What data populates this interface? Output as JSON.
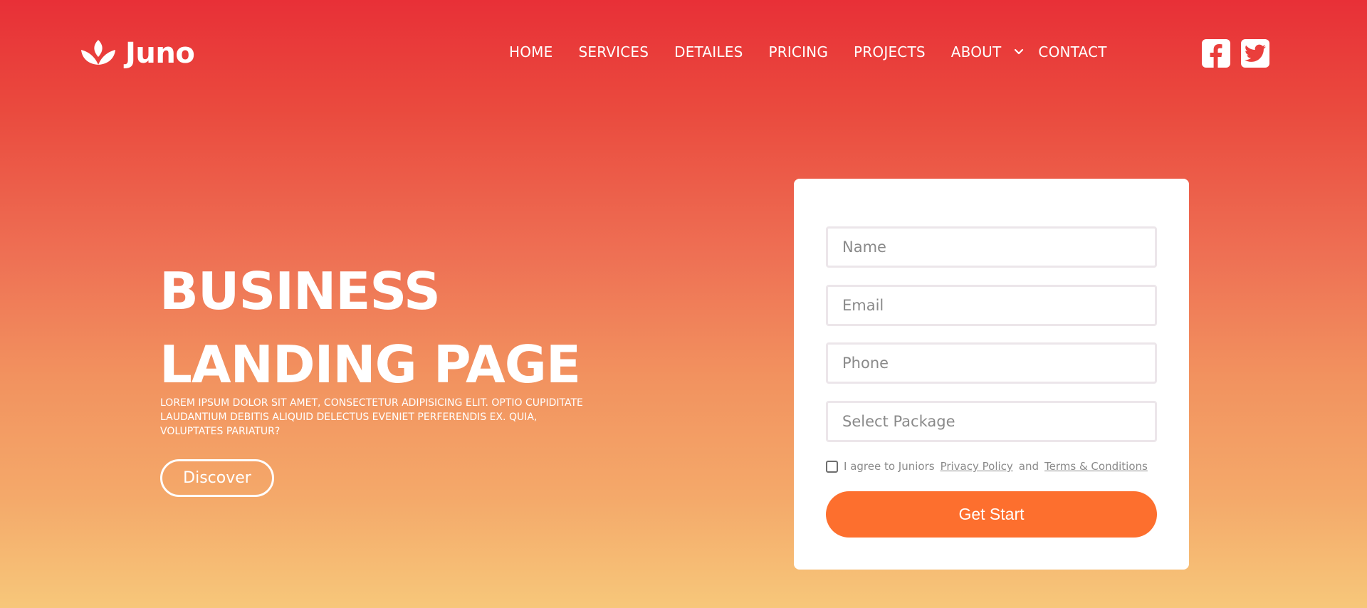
{
  "brand": {
    "name": "Juno",
    "icon": "lotus-icon"
  },
  "nav": {
    "items": [
      {
        "label": "HOME"
      },
      {
        "label": "SERVICES"
      },
      {
        "label": "DETAILES"
      },
      {
        "label": "PRICING"
      },
      {
        "label": "PROJECTS"
      },
      {
        "label": "ABOUT"
      },
      {
        "label": "CONTACT"
      }
    ],
    "about_dropdown_icon": "chevron-down-icon"
  },
  "socials": [
    {
      "name": "facebook",
      "icon": "facebook-icon"
    },
    {
      "name": "twitter",
      "icon": "twitter-icon"
    }
  ],
  "hero": {
    "title_line1": "BUSINESS",
    "title_line2": "LANDING PAGE",
    "description": "Lorem ipsum dolor sit amet, consectetur adipisicing elit. Optio cupiditate laudantium debitis aliquid delectus eveniet perferendis ex. Quia, voluptates pariatur?",
    "cta_label": "Discover"
  },
  "form": {
    "name_placeholder": "Name",
    "email_placeholder": "Email",
    "phone_placeholder": "Phone",
    "package_placeholder": "Select Package",
    "agree_prefix": "I agree to Juniors",
    "privacy_link": "Privacy Policy",
    "agree_and": "and",
    "terms_link": "Terms & Conditions",
    "submit_label": "Get Start"
  },
  "colors": {
    "gradient_top": "#e83037",
    "gradient_bottom": "#f7c77a",
    "submit_button": "#fd6f2e",
    "card": "#ffffff"
  }
}
